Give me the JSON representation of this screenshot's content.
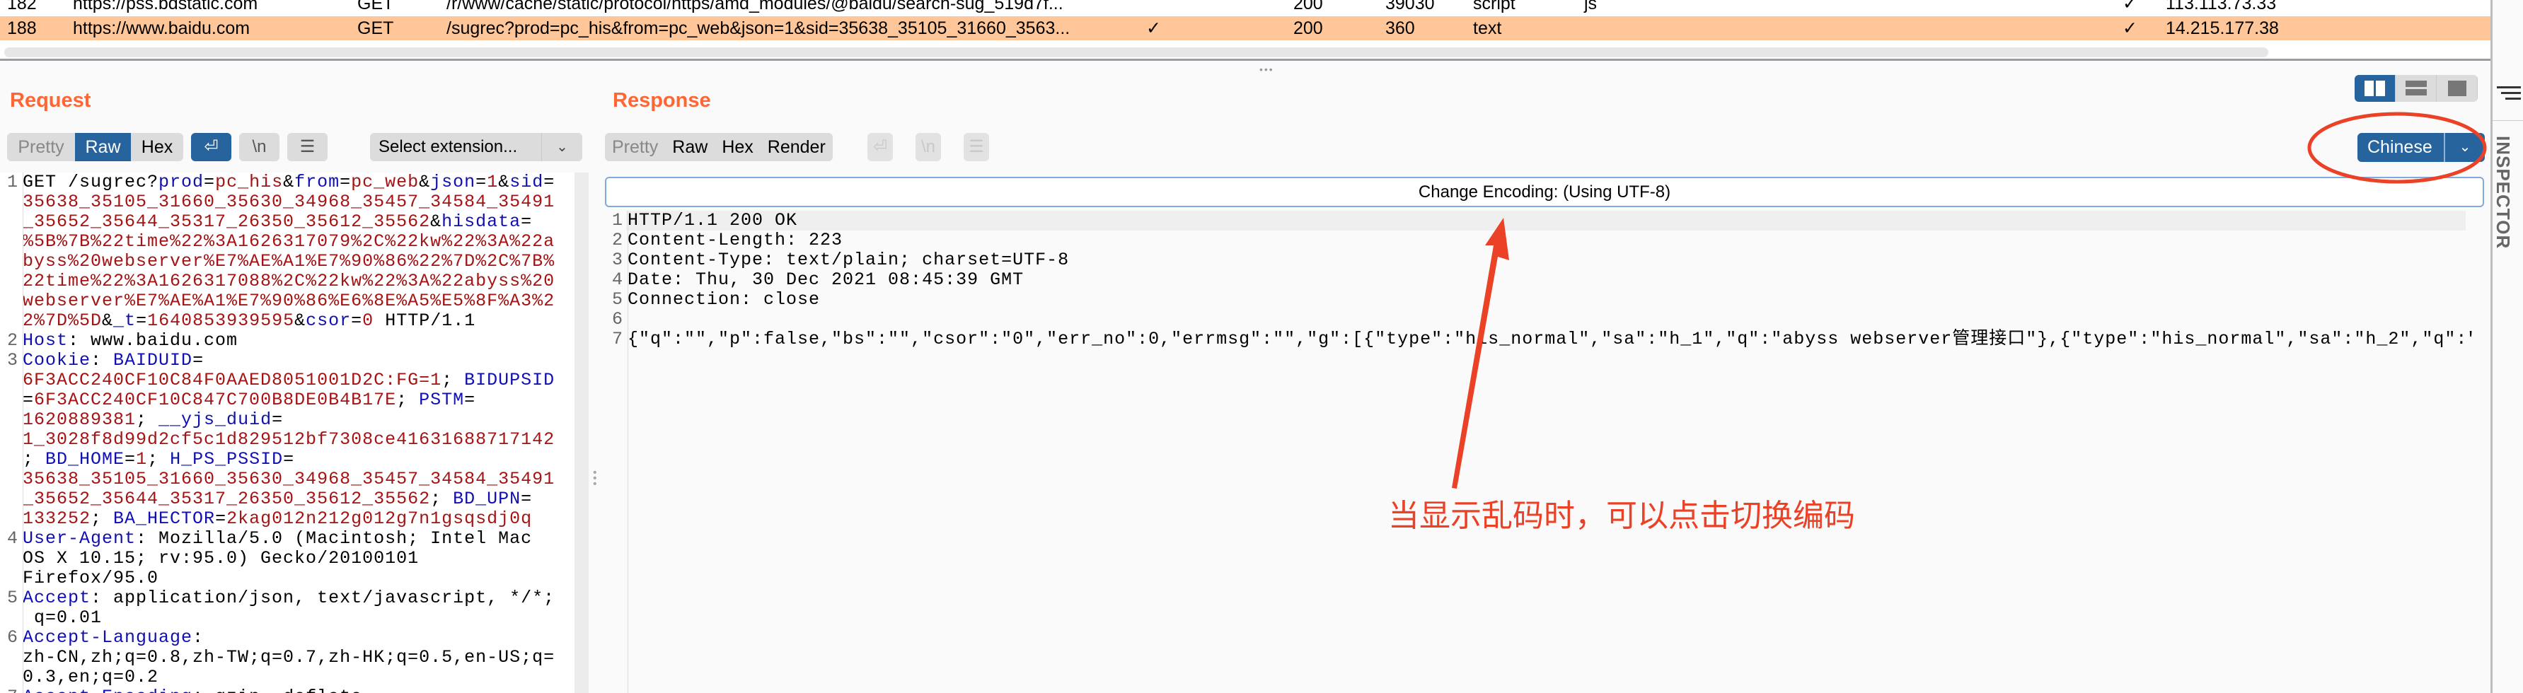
{
  "table": {
    "rows": [
      {
        "num": "182",
        "host": "https://pss.bdstatic.com",
        "method": "GET",
        "url": "/r/www/cache/static/protocol/https/amd_modules/@baidu/search-sug_519d7f...",
        "params": "",
        "status": "200",
        "length": "39030",
        "mime": "script",
        "ext": "js",
        "tls": "✓",
        "ip": "113.113.73.33",
        "selected": false
      },
      {
        "num": "188",
        "host": "https://www.baidu.com",
        "method": "GET",
        "url": "/sugrec?prod=pc_his&from=pc_web&json=1&sid=35638_35105_31660_3563...",
        "params": "✓",
        "status": "200",
        "length": "360",
        "mime": "text",
        "ext": "",
        "tls": "✓",
        "ip": "14.215.177.38",
        "selected": true
      }
    ]
  },
  "request": {
    "title": "Request",
    "view_tabs": [
      "Pretty",
      "Raw",
      "Hex"
    ],
    "active_tab": "Raw",
    "icons": [
      "wrap-lines-icon",
      "newline-icon",
      "menu-icon"
    ],
    "select_extension": "Select extension...",
    "lines": [
      {
        "n": "1",
        "v": [
          [
            [
              "p",
              "GET /sugrec?"
            ],
            [
              "k",
              "prod"
            ],
            [
              "p",
              "="
            ],
            [
              "v",
              "pc_his"
            ],
            [
              "p",
              "&"
            ],
            [
              "k",
              "from"
            ],
            [
              "p",
              "="
            ],
            [
              "v",
              "pc_web"
            ],
            [
              "p",
              "&"
            ],
            [
              "k",
              "json"
            ],
            [
              "p",
              "="
            ],
            [
              "v",
              "1"
            ],
            [
              "p",
              "&"
            ],
            [
              "k",
              "sid"
            ],
            [
              "p",
              "="
            ]
          ],
          [
            [
              "v",
              "35638_35105_31660_35630_34968_35457_34584_35491"
            ]
          ],
          [
            [
              "v",
              "_35652_35644_35317_26350_35612_35562"
            ],
            [
              "p",
              "&"
            ],
            [
              "k",
              "hisdata"
            ],
            [
              "p",
              "="
            ]
          ],
          [
            [
              "v",
              "%5B%7B%22time%22%3A1626317079%2C%22kw%22%3A%22a"
            ]
          ],
          [
            [
              "v",
              "byss%20webserver%E7%AE%A1%E7%90%86%22%7D%2C%7B%"
            ]
          ],
          [
            [
              "v",
              "22time%22%3A1626317088%2C%22kw%22%3A%22abyss%20"
            ]
          ],
          [
            [
              "v",
              "webserver%E7%AE%A1%E7%90%86%E6%8E%A5%E5%8F%A3%2"
            ]
          ],
          [
            [
              "v",
              "2%7D%5D"
            ],
            [
              "p",
              "&"
            ],
            [
              "k",
              "_t"
            ],
            [
              "p",
              "="
            ],
            [
              "v",
              "1640853939595"
            ],
            [
              "p",
              "&"
            ],
            [
              "k",
              "csor"
            ],
            [
              "p",
              "="
            ],
            [
              "v",
              "0"
            ],
            [
              "p",
              " HTTP/1.1"
            ]
          ]
        ]
      },
      {
        "n": "2",
        "v": [
          [
            [
              "k",
              "Host"
            ],
            [
              "p",
              ": www.baidu.com"
            ]
          ]
        ]
      },
      {
        "n": "3",
        "v": [
          [
            [
              "k",
              "Cookie"
            ],
            [
              "p",
              ": "
            ],
            [
              "k",
              "BAIDUID"
            ],
            [
              "p",
              "="
            ]
          ],
          [
            [
              "v",
              "6F3ACC240CF10C84F0AAED8051001D2C:FG=1"
            ],
            [
              "p",
              "; "
            ],
            [
              "k",
              "BIDUPSID"
            ]
          ],
          [
            [
              "p",
              "="
            ],
            [
              "v",
              "6F3ACC240CF10C847C700B8DE0B4B17E"
            ],
            [
              "p",
              "; "
            ],
            [
              "k",
              "PSTM"
            ],
            [
              "p",
              "="
            ]
          ],
          [
            [
              "v",
              "1620889381"
            ],
            [
              "p",
              "; "
            ],
            [
              "k",
              "__yjs_duid"
            ],
            [
              "p",
              "="
            ]
          ],
          [
            [
              "v",
              "1_3028f8d99d2cf5c1d829512bf7308ce41631688717142"
            ]
          ],
          [
            [
              "p",
              "; "
            ],
            [
              "k",
              "BD_HOME"
            ],
            [
              "p",
              "="
            ],
            [
              "v",
              "1"
            ],
            [
              "p",
              "; "
            ],
            [
              "k",
              "H_PS_PSSID"
            ],
            [
              "p",
              "="
            ]
          ],
          [
            [
              "v",
              "35638_35105_31660_35630_34968_35457_34584_35491"
            ]
          ],
          [
            [
              "v",
              "_35652_35644_35317_26350_35612_35562"
            ],
            [
              "p",
              "; "
            ],
            [
              "k",
              "BD_UPN"
            ],
            [
              "p",
              "="
            ]
          ],
          [
            [
              "v",
              "133252"
            ],
            [
              "p",
              "; "
            ],
            [
              "k",
              "BA_HECTOR"
            ],
            [
              "p",
              "="
            ],
            [
              "v",
              "2kag012n212g012g7n1gsqsdj0q"
            ]
          ]
        ]
      },
      {
        "n": "4",
        "v": [
          [
            [
              "k",
              "User-Agent"
            ],
            [
              "p",
              ": Mozilla/5.0 (Macintosh; Intel Mac"
            ]
          ],
          [
            [
              "p",
              "OS X 10.15; rv:95.0) Gecko/20100101"
            ]
          ],
          [
            [
              "p",
              "Firefox/95.0"
            ]
          ]
        ]
      },
      {
        "n": "5",
        "v": [
          [
            [
              "k",
              "Accept"
            ],
            [
              "p",
              ": application/json, text/javascript, */*;"
            ]
          ],
          [
            [
              "p",
              " q=0.01"
            ]
          ]
        ]
      },
      {
        "n": "6",
        "v": [
          [
            [
              "k",
              "Accept-Language"
            ],
            [
              "p",
              ":"
            ]
          ],
          [
            [
              "p",
              "zh-CN,zh;q=0.8,zh-TW;q=0.7,zh-HK;q=0.5,en-US;q="
            ]
          ],
          [
            [
              "p",
              "0.3,en;q=0.2"
            ]
          ]
        ]
      },
      {
        "n": "7",
        "v": [
          [
            [
              "k",
              "Accept-Encoding"
            ],
            [
              "p",
              ": gzip, deflate"
            ]
          ]
        ]
      }
    ]
  },
  "response": {
    "title": "Response",
    "view_tabs": [
      "Pretty",
      "Raw",
      "Hex",
      "Render"
    ],
    "encoding_button": "Chinese",
    "encoding_bar": "Change Encoding: (Using UTF-8)",
    "lines": [
      {
        "n": "1",
        "t": "HTTP/1.1 200 OK"
      },
      {
        "n": "2",
        "t": "Content-Length: 223"
      },
      {
        "n": "3",
        "t": "Content-Type: text/plain; charset=UTF-8"
      },
      {
        "n": "4",
        "t": "Date: Thu, 30 Dec 2021 08:45:39 GMT"
      },
      {
        "n": "5",
        "t": "Connection: close"
      },
      {
        "n": "6",
        "t": ""
      },
      {
        "n": "7",
        "t": "{\"q\":\"\",\"p\":false,\"bs\":\"\",\"csor\":\"0\",\"err_no\":0,\"errmsg\":\"\",\"g\":[{\"type\":\"his_normal\",\"sa\":\"h_1\",\"q\":\"abyss webserver管理接口\"},{\"type\":\"his_normal\",\"sa\":\"h_2\",\"q\":\""
      }
    ]
  },
  "inspector": {
    "label": "INSPECTOR"
  },
  "annotation": {
    "text": "当显示乱码时，可以点击切换编码",
    "color": "#ea4127"
  },
  "colors": {
    "accent": "#27649e",
    "title": "#ff6633",
    "selected_row": "#ffc799",
    "key": "#1010b0",
    "value": "#a31515"
  }
}
